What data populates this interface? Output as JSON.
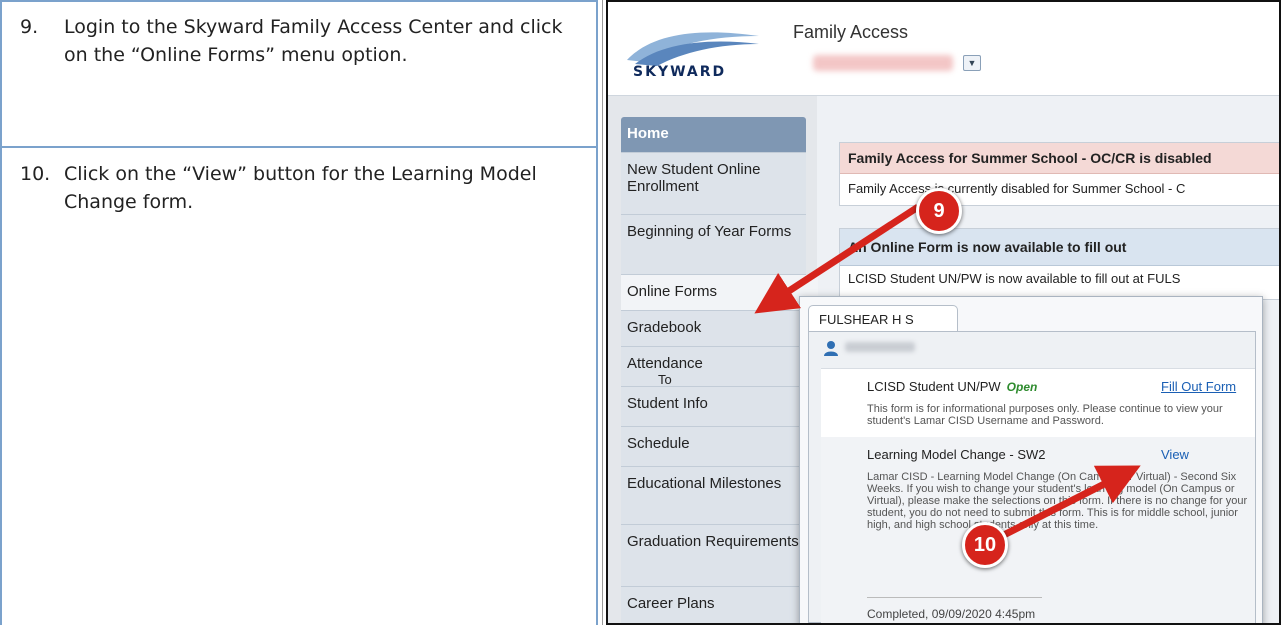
{
  "steps": [
    {
      "num": "9.",
      "text": "Login to the Skyward Family Access Center and click on the “Online Forms” menu option."
    },
    {
      "num": "10.",
      "text": "Click on the “View” button for the Learning Model Change form."
    }
  ],
  "app": {
    "logo_text": "SKYWARD",
    "title": "Family Access"
  },
  "nav": [
    "Home",
    "New Student Online Enrollment",
    "Beginning of Year Forms",
    "Online Forms",
    "Gradebook",
    "Attendance",
    "Student Info",
    "Schedule",
    "Educational Milestones",
    "Graduation Requirements",
    "Career Plans"
  ],
  "messages": {
    "summer_title": "Family Access for Summer School - OC/CR is disabled",
    "summer_body": "Family Access is currently disabled for Summer School - C",
    "form_title": "An Online Form is now available to fill out",
    "form_body": "LCISD Student UN/PW is now available to fill out at FULS"
  },
  "popup": {
    "school_tab": "FULSHEAR H S",
    "forms": [
      {
        "title": "LCISD Student UN/PW",
        "status": "Open",
        "action": "Fill Out Form",
        "description": "This form is for informational purposes only. Please continue to view your student's Lamar CISD Username and Password."
      },
      {
        "title": "Learning Model Change - SW2",
        "action": "View",
        "description": "Lamar CISD - Learning Model Change (On Campus or Virtual) - Second Six Weeks. If you wish to change your student's learning model (On Campus or Virtual), please make the selections on this form. If there is no change for your student, you do not need to submit this form. This is for middle school, junior high, and high school students only at this time.",
        "completed": "Completed, 09/09/2020 4:45pm"
      }
    ]
  },
  "callouts": {
    "first": "9",
    "second": "10"
  },
  "colors": {
    "callout": "#d6241c",
    "table_border": "#7ba2cc",
    "nav_active": "#7f97b3"
  }
}
